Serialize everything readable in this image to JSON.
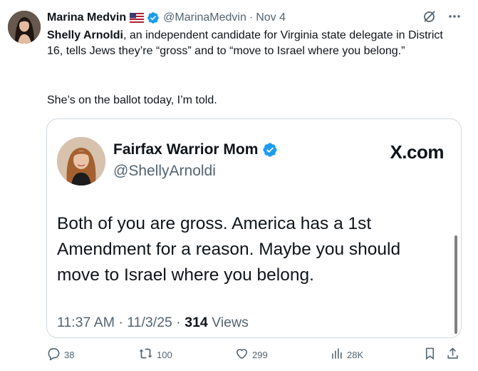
{
  "tweet": {
    "author_name": "Marina Medvin",
    "handle": "@MarinaMedvin",
    "separator": "·",
    "date": "Nov 4",
    "text_bold": "Shelly Arnoldi",
    "text_rest": ", an independent candidate for Virginia state delegate in District 16,  tells Jews they’re “gross” and to “move to Israel where you belong.”",
    "text_para2": "She’s on the ballot today, I’m told."
  },
  "card": {
    "name": "Fairfax Warrior Mom",
    "handle": "@ShellyArnoldi",
    "source": "X.com",
    "text": "Both of you are gross. America has a 1st Amendment for a reason. Maybe you should move to Israel where you belong.",
    "time": "11:37 AM · 11/3/25 · ",
    "views_count": "314",
    "views_label": " Views"
  },
  "actions": {
    "replies": "38",
    "reposts": "100",
    "likes": "299",
    "views": "28K"
  },
  "colors": {
    "verified": "#1d9bf0",
    "muted": "#536471",
    "text": "#0f1419",
    "border": "#cfd9de"
  },
  "icons": [
    "us-flag-icon",
    "verified-badge-icon",
    "grok-icon",
    "more-icon",
    "reply-icon",
    "repost-icon",
    "like-icon",
    "views-icon",
    "bookmark-icon",
    "share-icon"
  ]
}
